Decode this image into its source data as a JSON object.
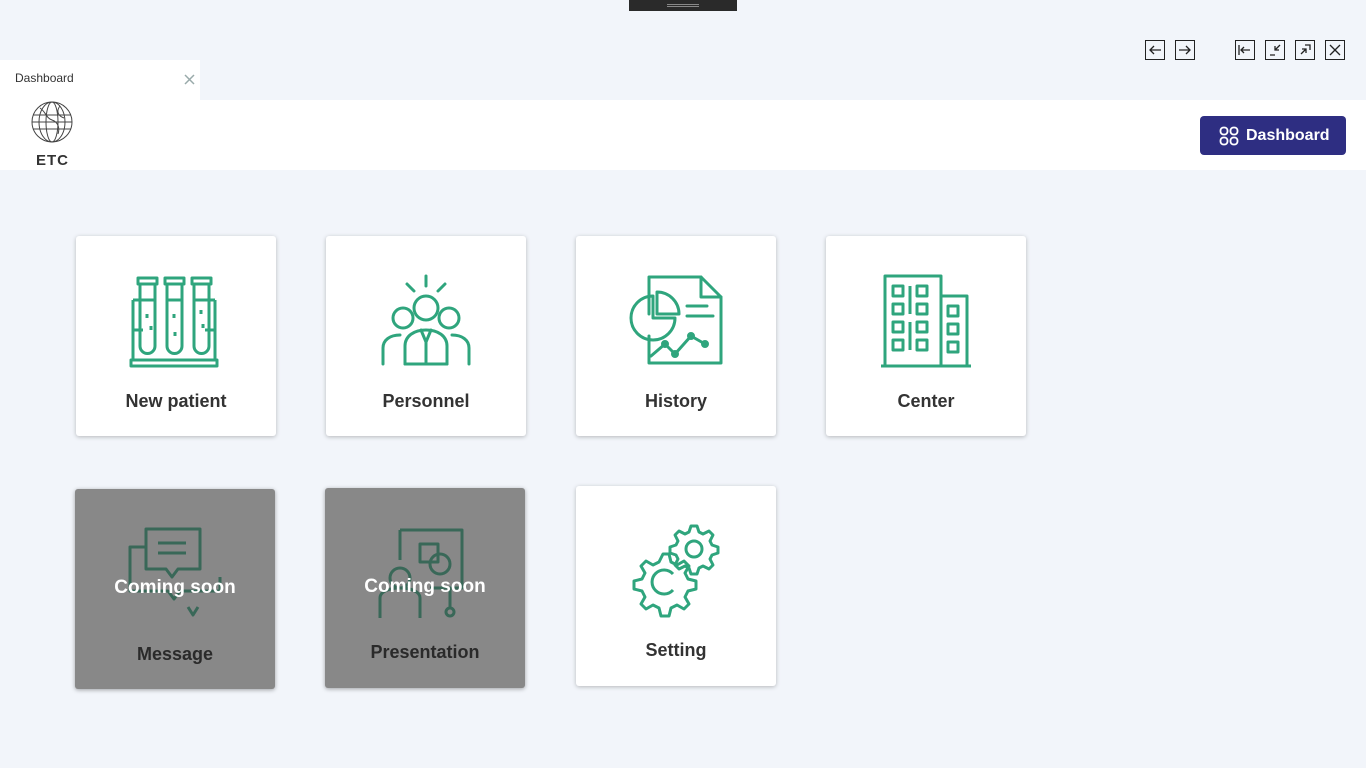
{
  "tab": {
    "title": "Dashboard"
  },
  "header": {
    "logo_text": "ETC",
    "dashboard_button": "Dashboard"
  },
  "cards": [
    {
      "label": "New patient",
      "icon": "test-tubes-icon",
      "enabled": true
    },
    {
      "label": "Personnel",
      "icon": "team-icon",
      "enabled": true
    },
    {
      "label": "History",
      "icon": "report-chart-icon",
      "enabled": true
    },
    {
      "label": "Center",
      "icon": "building-icon",
      "enabled": true
    },
    {
      "label": "Message",
      "icon": "chat-bubbles-icon",
      "enabled": false,
      "badge": "Coming soon"
    },
    {
      "label": "Presentation",
      "icon": "presentation-icon",
      "enabled": false,
      "badge": "Coming soon"
    },
    {
      "label": "Setting",
      "icon": "gears-icon",
      "enabled": true
    }
  ],
  "colors": {
    "accent": "#2e2e82",
    "icon_green": "#2fa57d",
    "disabled_card": "#888888",
    "background": "#f2f5fa"
  }
}
